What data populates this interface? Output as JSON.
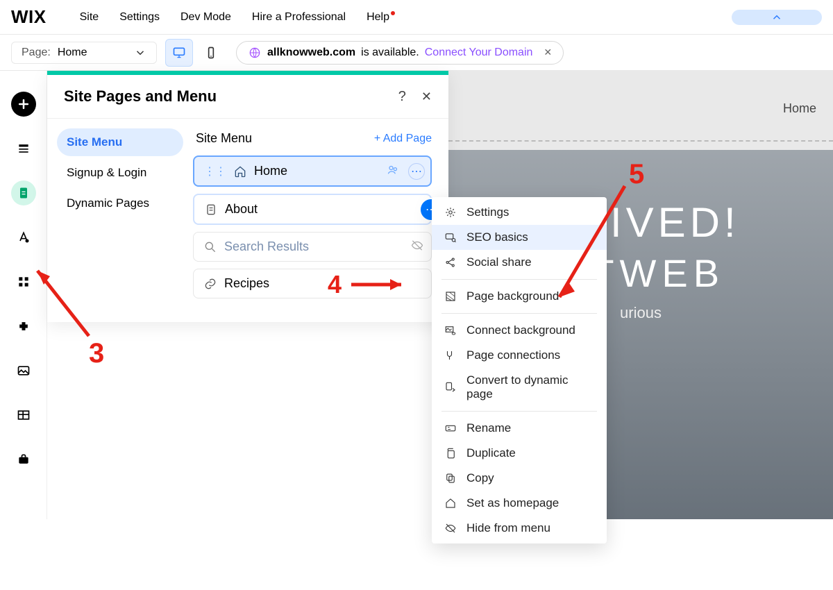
{
  "topmenu": {
    "logo": "WIX",
    "items": [
      "Site",
      "Settings",
      "Dev Mode",
      "Hire a Professional",
      "Help"
    ]
  },
  "pagepill": {
    "label": "Page:",
    "value": "Home"
  },
  "domainbar": {
    "domain": "allknowweb.com",
    "avail_text": "is available.",
    "connect": "Connect Your Domain"
  },
  "panel": {
    "title": "Site Pages and Menu",
    "tabs": [
      "Site Menu",
      "Signup & Login",
      "Dynamic Pages"
    ],
    "list_title": "Site Menu",
    "add_label": "+  Add Page",
    "items": [
      "Home",
      "About",
      "Search Results",
      "Recipes"
    ],
    "search_placeholder": "Search Results"
  },
  "ctx": {
    "settings": "Settings",
    "seo": "SEO basics",
    "social": "Social share",
    "pagebg": "Page background",
    "connectbg": "Connect background",
    "pageconn": "Page connections",
    "convert": "Convert to dynamic page",
    "rename": "Rename",
    "duplicate": "Duplicate",
    "copy": "Copy",
    "sethome": "Set as homepage",
    "hide": "Hide from menu"
  },
  "canvas": {
    "nav_home": "Home",
    "hero_line1": "RRIVED!",
    "hero_line2": "UTWEB",
    "hero_sub": "urious"
  },
  "annotations": {
    "n3": "3",
    "n4": "4",
    "n5": "5"
  }
}
